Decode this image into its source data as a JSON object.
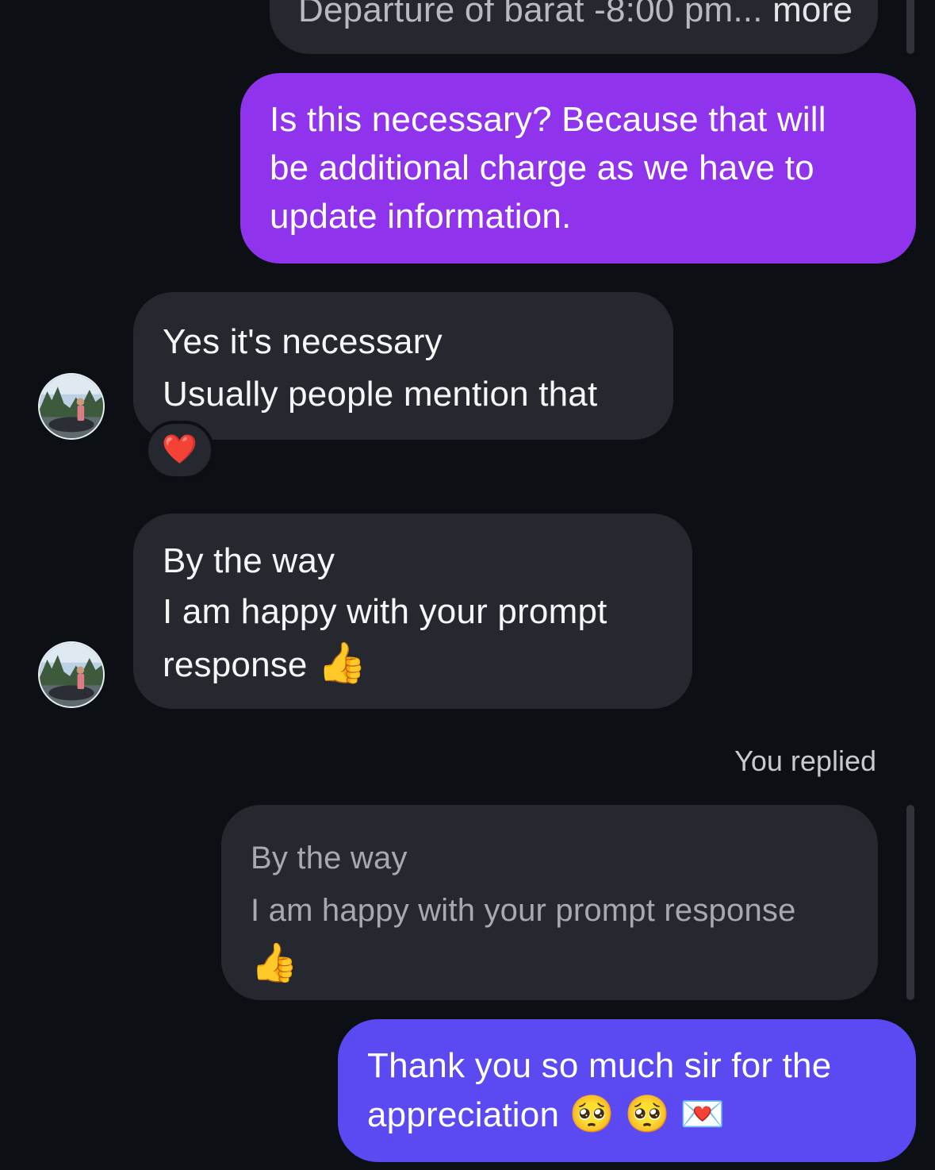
{
  "thread": {
    "top_preview": {
      "text": "Departure of barat -8:00 pm...",
      "more_label": "more"
    },
    "outgoing_1": {
      "lines": [
        "Is this necessary? Because that will",
        "be additional charge as we have to",
        "update information."
      ]
    },
    "incoming_1": {
      "lines": [
        "Yes it's necessary",
        "Usually people mention that"
      ],
      "reaction": "❤️"
    },
    "incoming_2": {
      "lines": [
        "By the way",
        "I am happy with your prompt",
        "response"
      ],
      "emoji": "👍"
    },
    "reply_label": "You replied",
    "quoted": {
      "lines": [
        "By the way",
        "I am happy with your prompt response"
      ],
      "emoji": "👍"
    },
    "outgoing_2": {
      "lines": [
        "Thank you so much sir for the",
        "appreciation"
      ],
      "emojis": [
        "🥺",
        "🥺",
        "💌"
      ]
    }
  },
  "colors": {
    "background": "#0c0f14",
    "incoming_bubble": "#26282f",
    "outgoing_purple": "#8f34ec",
    "outgoing_indigo": "#5b49f2",
    "secondary_text": "#c7c9cf"
  }
}
